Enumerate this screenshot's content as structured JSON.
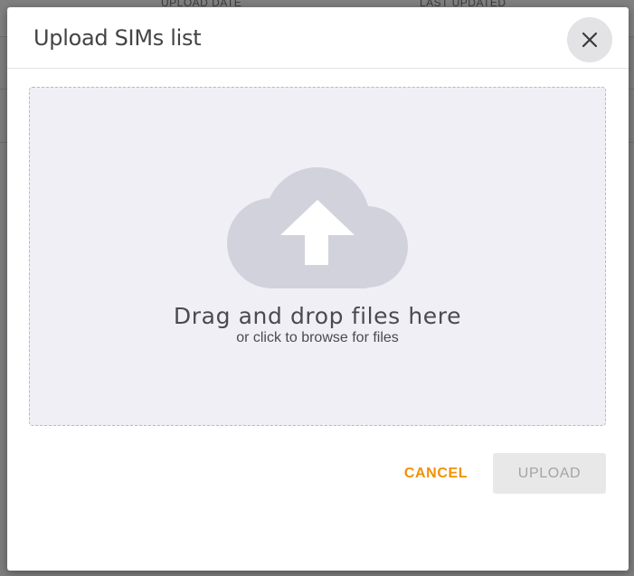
{
  "background": {
    "columns": [
      "UPLOAD DATE",
      "LAST UPDATED"
    ]
  },
  "dialog": {
    "title": "Upload SIMs list",
    "close_icon": "close-icon",
    "dropzone": {
      "icon": "cloud-upload-icon",
      "title": "Drag and drop files here",
      "subtitle": "or click to browse for files"
    },
    "cancel_label": "CANCEL",
    "upload_label": "UPLOAD",
    "upload_disabled": true
  },
  "colors": {
    "accent": "#f29100",
    "dropzone_bg": "#f0eff5",
    "cloud_icon": "#d2d2dd",
    "disabled_button_bg": "#e8e8e8",
    "disabled_button_text": "#a4a4a4"
  }
}
